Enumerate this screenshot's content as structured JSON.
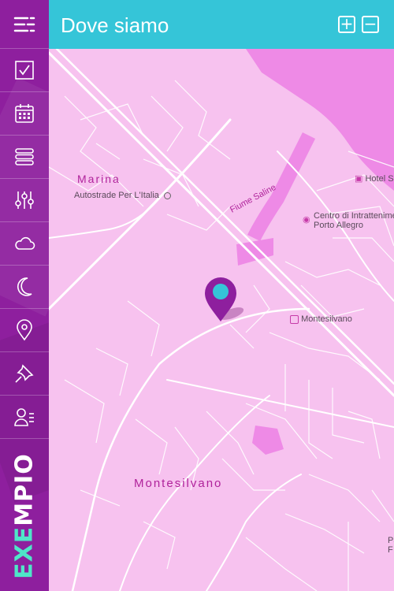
{
  "header": {
    "title": "Dove siamo",
    "zoom_in": "+",
    "zoom_out": "−"
  },
  "sidebar": {
    "items": [
      {
        "icon": "menu-icon"
      },
      {
        "icon": "checkbox-icon"
      },
      {
        "icon": "calendar-icon"
      },
      {
        "icon": "list-icon"
      },
      {
        "icon": "sliders-icon"
      },
      {
        "icon": "cloud-icon"
      },
      {
        "icon": "moon-icon"
      },
      {
        "icon": "location-pin-icon"
      },
      {
        "icon": "pushpin-icon"
      },
      {
        "icon": "contacts-icon"
      }
    ],
    "brand_a": "EXE",
    "brand_b": "MPIO"
  },
  "map": {
    "labels": {
      "marina": "Marina",
      "autostrade": "Autostrade Per L'Italia",
      "fiume": "Fiume Saline",
      "hotel": "Hotel Se",
      "centro_1": "Centro di Intrattenimer",
      "centro_2": "Porto Allegro",
      "station": "Montesilvano",
      "town": "Montesilvano",
      "edge_1": "Pa",
      "edge_2": "F"
    },
    "colors": {
      "land": "#f7c2ef",
      "water": "#ee8ae6",
      "road": "#ffffff",
      "pin": "#8e1f9e",
      "pin_dot": "#35c5d8"
    }
  }
}
